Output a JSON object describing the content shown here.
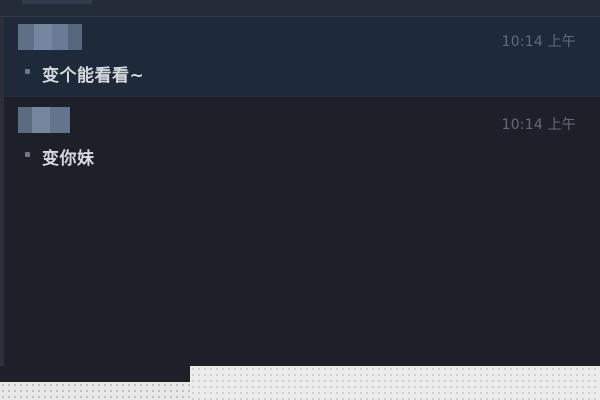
{
  "messages": [
    {
      "time": "10:14 上午",
      "text": "变个能看看~",
      "highlighted": true
    },
    {
      "time": "10:14 上午",
      "text": "变你妹",
      "highlighted": false
    }
  ],
  "colors": {
    "background": "#1d2029",
    "highlight": "#1e293a",
    "text": "#d6d9de",
    "timestamp": "#636a77"
  }
}
